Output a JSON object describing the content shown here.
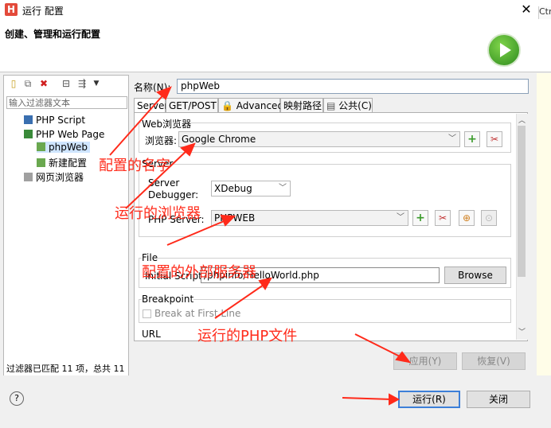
{
  "window": {
    "title": "运行 配置",
    "app_icon": "H",
    "close": "✕",
    "side_tab_text": "Ctrl"
  },
  "header": {
    "title": "创建、管理和运行配置"
  },
  "left_panel": {
    "filter_placeholder": "输入过滤器文本",
    "tree": [
      {
        "label": "PHP Script",
        "icon": "php-script-icon"
      },
      {
        "label": "PHP Web Page",
        "icon": "php-web-page-icon"
      },
      {
        "label": "phpWeb",
        "icon": "launch-config-icon",
        "selected": true
      },
      {
        "label": "新建配置",
        "icon": "launch-config-icon"
      },
      {
        "label": "网页浏览器",
        "icon": "web-browser-icon"
      }
    ],
    "status": "过滤器已匹配 11 项，总共 11"
  },
  "config": {
    "name_label": "名称(N):",
    "name_value": "phpWeb",
    "tabs": [
      "Server",
      "GET/POST",
      "Advanced",
      "映射路径",
      "公共(C)"
    ],
    "web_browser_group": "Web浏览器",
    "browser_label": "浏览器:",
    "browser_value": "Google Chrome",
    "server_group": "Server",
    "debugger_label_1": "Server",
    "debugger_label_2": "Debugger:",
    "debugger_value": "XDebug",
    "php_server_label": "PHP Server:",
    "php_server_value": "PHPWEB",
    "file_group": "File",
    "initial_script_label": "Initial Script:",
    "initial_script_value": "/phpinfo/HelloWorld.php",
    "browse_label": "Browse",
    "breakpoint_group": "Breakpoint",
    "break_first_line": "Break at First Line",
    "url_group": "URL",
    "apply_label": "应用(Y)",
    "revert_label": "恢复(V)"
  },
  "footer": {
    "help": "?",
    "run_label": "运行(R)",
    "close_label": "关闭"
  },
  "annotations": {
    "name": "配置的名字",
    "browser": "运行的浏览器",
    "server": "配置的外部服务器",
    "file": "运行的PHP文件"
  },
  "colors": {
    "annotation": "#ff2a1a",
    "accent": "#3c7fd8"
  }
}
